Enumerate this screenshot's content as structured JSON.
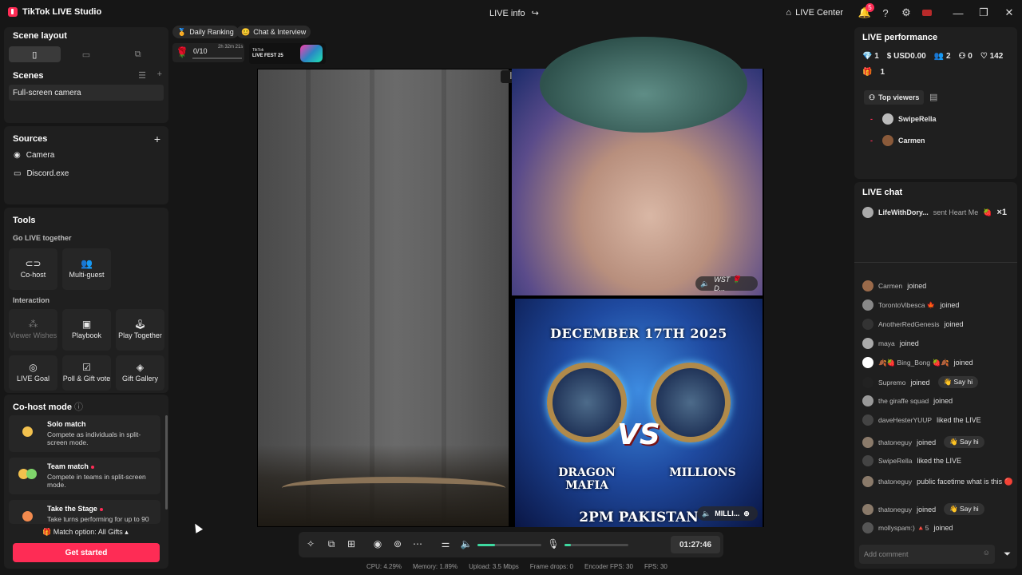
{
  "app": {
    "title": "TikTok LIVE Studio",
    "center_title": "LIVE info",
    "live_center": "LIVE Center",
    "notif_count": "5"
  },
  "scene_layout": {
    "title": "Scene layout"
  },
  "scenes": {
    "title": "Scenes",
    "items": [
      "Full-screen camera"
    ]
  },
  "sources": {
    "title": "Sources",
    "items": [
      "Camera",
      "Discord.exe"
    ]
  },
  "tools": {
    "title": "Tools",
    "go_live_together": "Go LIVE together",
    "cohost": "Co-host",
    "multiguest": "Multi-guest",
    "interaction": "Interaction",
    "viewer_wishes": "Viewer Wishes",
    "playbook": "Playbook",
    "play_together": "Play Together",
    "live_goal": "LIVE Goal",
    "poll": "Poll & Gift vote",
    "gift_gallery": "Gift Gallery"
  },
  "cohost_mode": {
    "title": "Co-host mode",
    "modes": [
      {
        "title": "Solo match",
        "desc": "Compete as individuals in split-screen mode."
      },
      {
        "title": "Team match",
        "desc": "Compete in teams in split-screen mode."
      },
      {
        "title": "Take the Stage",
        "desc": "Take turns performing for up to 90"
      }
    ],
    "match_option": "Match option: All Gifts",
    "get_started": "Get started"
  },
  "top_chips": {
    "daily_ranking": "Daily Ranking",
    "chat_interview": "Chat & Interview"
  },
  "goal": {
    "count": "0/10",
    "timer": "2h 32m 21s",
    "fest": "LIVE FEST 25",
    "fest_small": "TikTok"
  },
  "video": {
    "top_right_label": "WST 🌹 D...",
    "poster_date": "DECEMBER 17TH 2025",
    "left_name": "DRAGON MAFIA",
    "right_name": "MILLIONS",
    "vs": "VS",
    "bottom": "2PM PAKISTAN",
    "bottom_label": "MILLI..."
  },
  "controls": {
    "timer": "01:27:46",
    "volume": 0.28,
    "mic": 0.1
  },
  "stats": {
    "cpu": "CPU: 4.29%",
    "memory": "Memory: 1.89%",
    "upload": "Upload: 3.5 Mbps",
    "drops": "Frame drops: 0",
    "encoder": "Encoder FPS: 30",
    "fps": "FPS: 30"
  },
  "performance": {
    "title": "LIVE performance",
    "diamonds": "1",
    "usd": "USD0.00",
    "viewers": "2",
    "new": "0",
    "likes": "142",
    "gifts": "1",
    "top_viewers": "Top viewers",
    "viewers_list": [
      "SwipeRella",
      "Carmen"
    ]
  },
  "chat": {
    "title": "LIVE chat",
    "gift_user": "LifeWithDory...",
    "gift_text": "sent Heart Me",
    "gift_count": "×1",
    "lines": [
      {
        "user": "Carmen",
        "text": "joined",
        "sayhi": ""
      },
      {
        "user": "TorontoVibesca 🍁",
        "text": "joined",
        "sayhi": ""
      },
      {
        "user": "AnotherRedGenesis",
        "text": "joined",
        "sayhi": ""
      },
      {
        "user": "maya",
        "text": "joined",
        "sayhi": ""
      },
      {
        "user": "🍂🍓 Bing_Bong 🍓🍂",
        "text": "joined",
        "sayhi": ""
      },
      {
        "user": "Supremo",
        "text": "joined",
        "sayhi": "👋 Say hi"
      },
      {
        "user": "the giraffe squad",
        "text": "joined",
        "sayhi": ""
      },
      {
        "user": "daveHesterYUUP",
        "text": "liked the LIVE",
        "sayhi": ""
      },
      {
        "user": "thatoneguy",
        "text": "joined",
        "sayhi": "👋 Say hi"
      },
      {
        "user": "SwipeRella",
        "text": "liked the LIVE",
        "sayhi": ""
      },
      {
        "user": "thatoneguy",
        "text": "public facetime what is this 🔴",
        "sayhi": ""
      },
      {
        "user": "thatoneguy",
        "text": "joined",
        "sayhi": "👋 Say hi"
      },
      {
        "user": "mollyspam:) 🔺5",
        "text": "joined",
        "sayhi": ""
      }
    ],
    "add_comment": "Add comment"
  }
}
